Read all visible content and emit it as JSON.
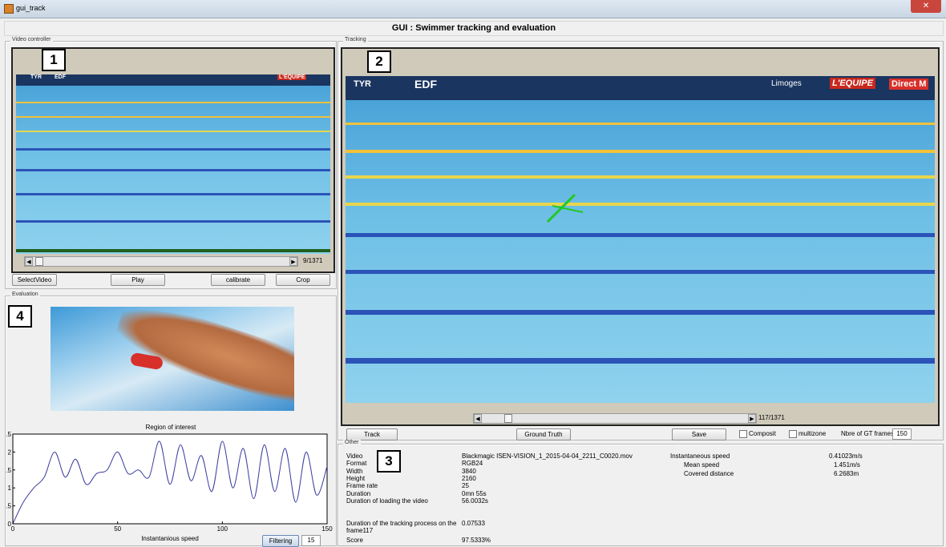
{
  "window": {
    "title": "gui_track",
    "close_glyph": "✕"
  },
  "app_title": "GUI : Swimmer tracking and evaluation",
  "video_controller": {
    "label": "Video controller",
    "marker": "1",
    "frame_counter": "9/1371",
    "progress": 0.006,
    "buttons": {
      "select_video": "SelectVideo",
      "play": "Play",
      "calibrate": "calibrate",
      "crop": "Crop"
    }
  },
  "tracking": {
    "label": "Tracking",
    "marker": "2",
    "frame_counter": "117/1371",
    "progress": 0.085,
    "buttons": {
      "track": "Track",
      "ground_truth": "Ground Truth",
      "save": "Save"
    },
    "composit_label": "Composit",
    "multizone_label": "multizone",
    "gt_frames_label": "Nbre of GT frames",
    "gt_frames_value": "150"
  },
  "banner_text": {
    "tyr": "TYR",
    "edf": "EDF",
    "limoges": "Limoges",
    "lequipe": "L'EQUIPE",
    "direct": "Direct M"
  },
  "evaluation": {
    "label": "Evaluation",
    "marker": "4",
    "roi_title": "Region of interest",
    "xlabel": "Instantanious speed",
    "filtering_label": "Filtering",
    "filtering_value": "15"
  },
  "other": {
    "label": "Other",
    "marker": "3",
    "rows": [
      {
        "key": "Video",
        "value": "Blackmagic ISEN-VISION_1_2015-04-04_2211_C0020.mov"
      },
      {
        "key": "Format",
        "value": "RGB24"
      },
      {
        "key": "Width",
        "value": "3840"
      },
      {
        "key": "Height",
        "value": "2160"
      },
      {
        "key": "Frame rate",
        "value": "25"
      },
      {
        "key": "Duration",
        "value": "0mn 55s"
      },
      {
        "key": "Duration of loading the video",
        "value": "56.0032s"
      }
    ],
    "tracking_duration_key": "Duration of the tracking process on the frame117",
    "tracking_duration_value": "0.07533",
    "score_key": "Score",
    "score_value": "97.5333%",
    "speed_rows": [
      {
        "key": "Instantaneous speed",
        "value": "0.41023m/s"
      },
      {
        "key": "Mean speed",
        "value": "1.451m/s"
      },
      {
        "key": "Covered distance",
        "value": "6.2683m"
      }
    ]
  },
  "chart_data": {
    "type": "line",
    "title": "Region of interest",
    "xlabel": "Instantanious speed",
    "xlim": [
      0,
      150
    ],
    "ylim": [
      0,
      2.5
    ],
    "xticks": [
      "0",
      "50",
      "100",
      "150"
    ],
    "yticks": [
      "0",
      ".5",
      "1",
      ".5",
      "2",
      ".5"
    ],
    "line_color": "#3a3aa0",
    "x": [
      0,
      5,
      10,
      15,
      20,
      25,
      30,
      35,
      40,
      45,
      50,
      55,
      60,
      65,
      70,
      75,
      80,
      85,
      90,
      95,
      100,
      105,
      110,
      115,
      120,
      125,
      130,
      135,
      140,
      145,
      150
    ],
    "y": [
      0,
      0.6,
      1.0,
      1.3,
      2.0,
      1.3,
      1.8,
      1.1,
      1.4,
      1.5,
      2.0,
      1.4,
      1.5,
      1.3,
      2.3,
      1.1,
      2.2,
      1.2,
      1.9,
      0.9,
      2.3,
      1.0,
      2.1,
      0.7,
      2.2,
      0.9,
      2.1,
      0.6,
      2.0,
      0.8,
      1.6
    ]
  }
}
